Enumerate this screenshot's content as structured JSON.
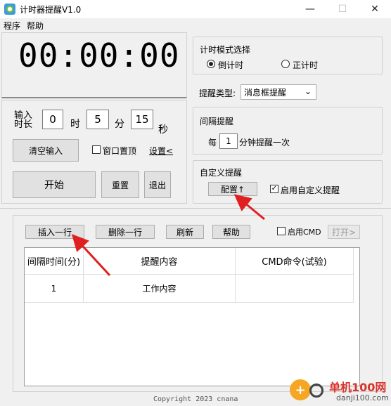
{
  "window": {
    "title": "计时器提醒V1.0",
    "minimize": "—",
    "maximize": "☐",
    "close": "✕"
  },
  "menu": [
    "程序",
    "帮助"
  ],
  "timer": {
    "display": "00:00:00"
  },
  "duration": {
    "label": "输入时长",
    "hours": "0",
    "hours_unit": "时",
    "minutes": "5",
    "minutes_unit": "分",
    "seconds": "15",
    "seconds_unit": "秒"
  },
  "controls": {
    "clear_input": "清空输入",
    "window_topmost": "窗口置顶",
    "settings_link": "设置<",
    "start": "开始",
    "reset": "重置",
    "exit": "退出"
  },
  "mode": {
    "title": "计时模式选择",
    "countdown": "倒计时",
    "countup": "正计时",
    "selected": "countdown"
  },
  "reminder_type": {
    "label": "提醒类型:",
    "value": "消息框提醒"
  },
  "interval": {
    "title": "间隔提醒",
    "prefix": "每",
    "value": "1",
    "suffix": "分钟提醒一次"
  },
  "custom": {
    "title": "自定义提醒",
    "config_button": "配置↑",
    "enable_label": "启用自定义提醒",
    "enabled": true
  },
  "toolbar": {
    "insert_row": "插入一行",
    "delete_row": "删除一行",
    "refresh": "刷新",
    "help": "帮助",
    "enable_cmd": "启用CMD",
    "open": "打开>"
  },
  "table": {
    "headers": [
      "间隔时间(分)",
      "提醒内容",
      "CMD命令(试验)"
    ],
    "rows": [
      [
        "1",
        "工作内容",
        ""
      ]
    ]
  },
  "footer": {
    "copyright": "Copyright 2023 cnana"
  },
  "watermark": {
    "site": "单机100网",
    "url": "danji100.com"
  }
}
